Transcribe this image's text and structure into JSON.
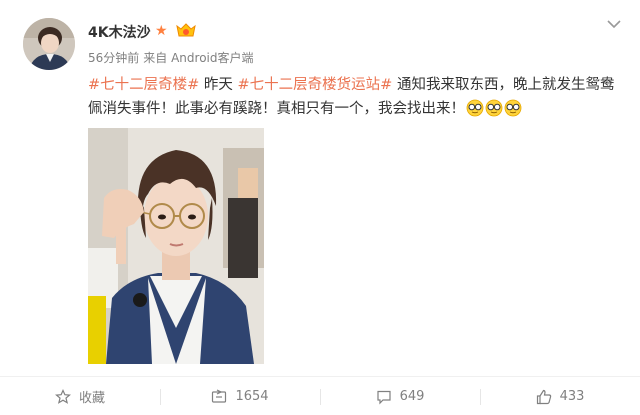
{
  "post": {
    "username": "4K木法沙",
    "time": "56分钟前",
    "source": "来自 Android客户端",
    "content": {
      "topic1": "#七十二层奇楼#",
      "text1": " 昨天 ",
      "topic2": "#七十二层奇楼货运站#",
      "text2": " 通知我来取东西，晚上就发生鸳鸯佩消失事件！此事必有蹊跷！真相只有一个，我会找出来！"
    },
    "emojis": [
      "glasses-emoji",
      "glasses-emoji",
      "glasses-emoji"
    ]
  },
  "actions": {
    "favorite": {
      "label": "收藏",
      "icon": "star-outline-icon"
    },
    "repost": {
      "label": "1654",
      "icon": "repost-icon"
    },
    "comment": {
      "label": "649",
      "icon": "comment-icon"
    },
    "like": {
      "label": "433",
      "icon": "thumbs-up-icon"
    }
  },
  "colors": {
    "topic": "#eb7350",
    "meta": "#808080",
    "text": "#333333",
    "verified": "#ff8140"
  }
}
